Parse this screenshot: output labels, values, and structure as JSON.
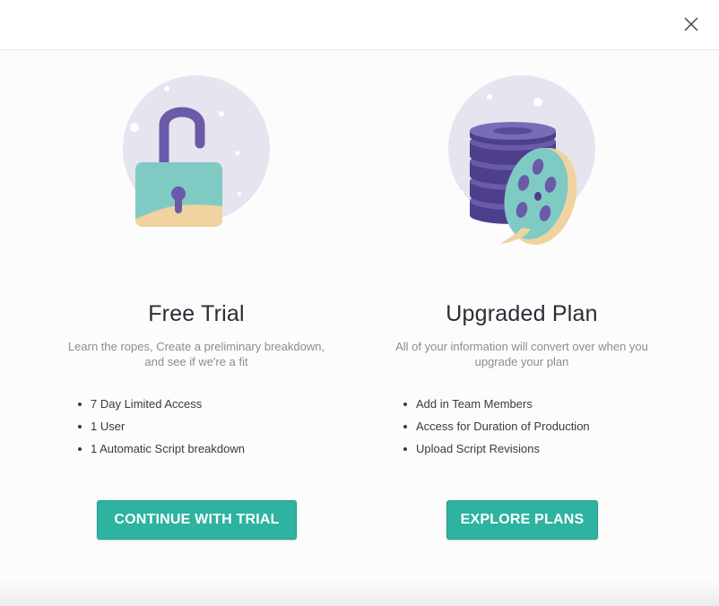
{
  "header": {
    "close_icon": "close-icon"
  },
  "plans": [
    {
      "title": "Free Trial",
      "description": "Learn the ropes, Create a preliminary breakdown, and see if we're a fit",
      "features": [
        "7 Day Limited Access",
        "1 User",
        "1 Automatic Script breakdown"
      ],
      "button_label": "CONTINUE WITH TRIAL",
      "illustration_icon": "unlocked-padlock-icon"
    },
    {
      "title": "Upgraded Plan",
      "description": "All of your information will convert over when you upgrade your plan",
      "features": [
        "Add in Team Members",
        "Access for Duration of Production",
        "Upload Script Revisions"
      ],
      "button_label": "EXPLORE PLANS",
      "illustration_icon": "film-reel-stack-icon"
    }
  ],
  "colors": {
    "accent": "#2db3a0",
    "illustration_bg": "#e6e4ee",
    "purple": "#6a5aa8",
    "teal": "#7fcbc4",
    "sand": "#f0d39e"
  }
}
